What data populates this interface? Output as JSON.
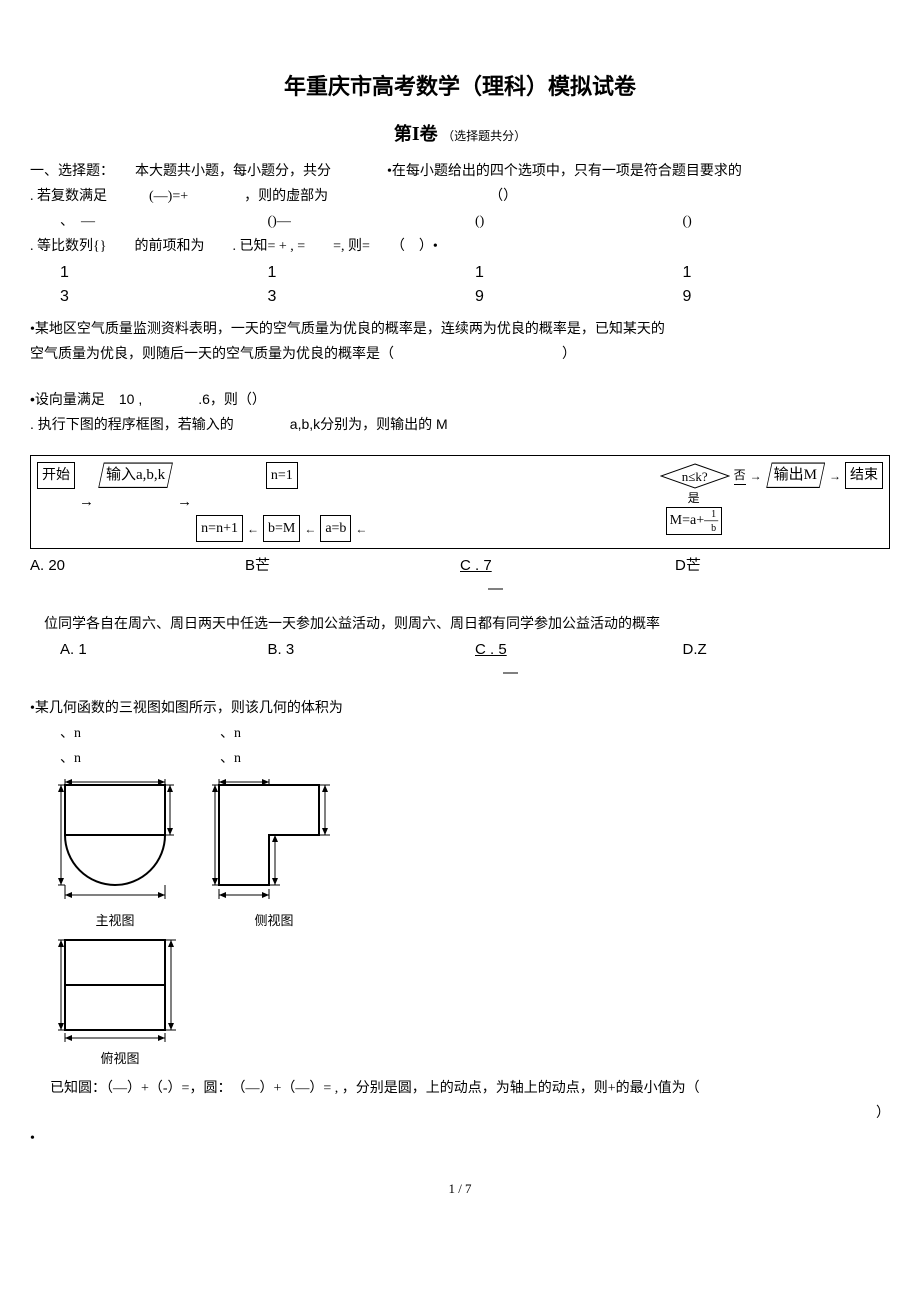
{
  "title": "年重庆市高考数学（理科）模拟试卷",
  "section_label_prefix": "第",
  "section_index": "I",
  "section_label_suffix": "卷",
  "section_note": "（选择题共分）",
  "q_intro": "一、选择题：　　本大题共小题，每小题分，共分　　　　•在每小题给出的四个选项中，只有一项是符合题目要求的",
  "q1": ". 若复数满足　　　(—)=+　　　　，则的虚部为　　　　　　　　　　　　（）",
  "q1_opts": {
    "a": "、　—",
    "b": "()—",
    "c": "()",
    "d": "()"
  },
  "q2": ". 等比数列{}　　的前项和为　　. 已知= + , =　　=, 则=　　（　）•",
  "q2_opts": {
    "a": "1",
    "b": "1",
    "c": "1",
    "d": "1"
  },
  "q2_opts2": {
    "a": "3",
    "b": "3",
    "c": "9",
    "d": "9"
  },
  "q3a": "•某地区空气质量监测资料表明，一天的空气质量为优良的概率是，连续两为优良的概率是，已知某天的",
  "q3b": "空气质量为优良，则随后一天的空气质量为优良的概率是（　　　　　　　　　　　　）",
  "q4": "•设向量满足　10 ,　　　　.6，则（）",
  "q5": ". 执行下图的程序框图，若输入的　　　　a,b,k分别为，则输出的 M",
  "flow": {
    "start": "开始",
    "input": "输入a,b,k",
    "n1": "n=1",
    "cond": "n≤k?",
    "yes": "是",
    "no": "否",
    "out": "输出M",
    "end": "结束",
    "nn": "n=n+1",
    "bm": "b=M",
    "ab": "a=b",
    "ma": "M=a+1/b",
    "ma_display_top": "1",
    "ma_display": "M=a+—",
    "ma_display_bot": "b"
  },
  "q5_opts": {
    "a": "A. 20",
    "b": "B芒",
    "c": "C . 7",
    "c2": "—",
    "d": "D芒"
  },
  "q6": "　位同学各自在周六、周日两天中任选一天参加公益活动，则周六、周日都有同学参加公益活动的概率",
  "q6_opts": {
    "a": "A. 1",
    "b": "B. 3",
    "c": "C . 5",
    "c2": "—",
    "d": "D.Z"
  },
  "q7": "•某几何函数的三视图如图所示，则该几何的体积为",
  "q7_row1": {
    "a": "、n",
    "b": "、n"
  },
  "q7_row2": {
    "a": "、n",
    "b": "、n"
  },
  "view_labels": {
    "front": "主视图",
    "side": "侧视图",
    "top": "俯视图"
  },
  "q8": "已知圆：（—）+（-）=，圆：　（—）+（—）= , ，分别是圆，上的动点，为轴上的动点，则+的最小值为（",
  "q8_close": "）",
  "dot": "•",
  "page": "1 / 7"
}
